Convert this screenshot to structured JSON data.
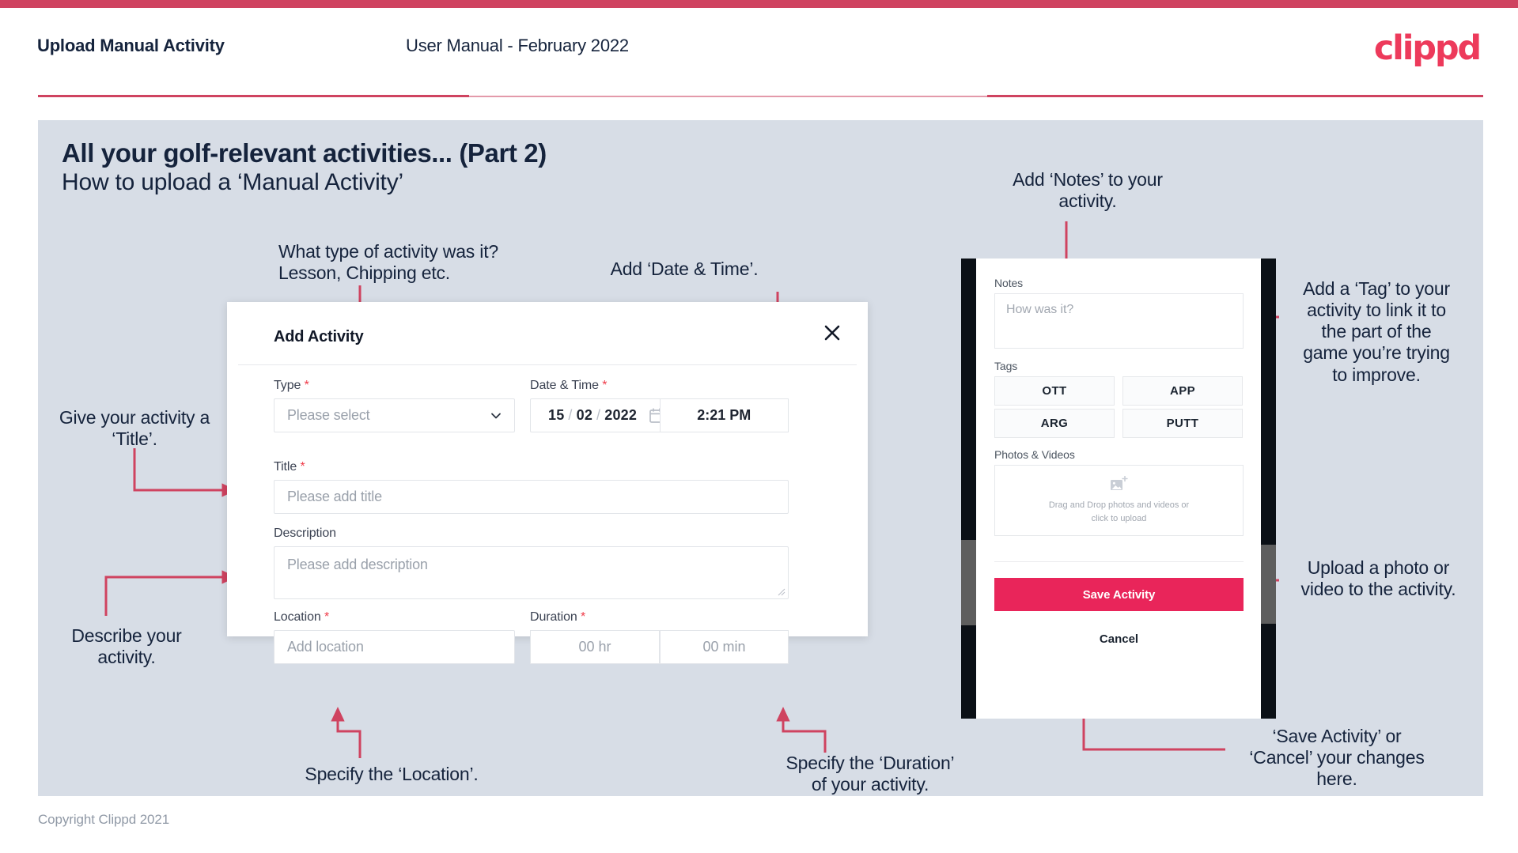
{
  "header": {
    "title": "Upload Manual Activity",
    "subtitle": "User Manual - February 2022",
    "logo": "clippd"
  },
  "slide": {
    "title": "All your golf-relevant activities... (Part 2)",
    "subtitle": "How to upload a ‘Manual Activity’"
  },
  "annotations": {
    "type": "What type of activity was it?\nLesson, Chipping etc.",
    "datetime": "Add ‘Date & Time’.",
    "title": "Give your activity a\n‘Title’.",
    "description": "Describe your\nactivity.",
    "location": "Specify the ‘Location’.",
    "duration": "Specify the ‘Duration’\nof your activity.",
    "notes": "Add ‘Notes’ to your\nactivity.",
    "tags": "Add a ‘Tag’ to your\nactivity to link it to\nthe part of the\ngame you’re trying\nto improve.",
    "upload": "Upload a photo or\nvideo to the activity.",
    "save": "‘Save Activity’ or\n‘Cancel’ your changes\nhere."
  },
  "dialog": {
    "title": "Add Activity",
    "close_label": "✕",
    "fields": {
      "type": {
        "label": "Type",
        "required": true,
        "placeholder": "Please select"
      },
      "datetime": {
        "label": "Date & Time",
        "required": true,
        "day": "15",
        "month": "02",
        "year": "2022",
        "separator": "/",
        "time": "2:21 PM"
      },
      "title": {
        "label": "Title",
        "required": true,
        "placeholder": "Please add title"
      },
      "description": {
        "label": "Description",
        "required": false,
        "placeholder": "Please add description"
      },
      "location": {
        "label": "Location",
        "required": true,
        "placeholder": "Add location"
      },
      "duration": {
        "label": "Duration",
        "required": true,
        "hours": "00 hr",
        "minutes": "00 min"
      }
    }
  },
  "phone": {
    "notes": {
      "label": "Notes",
      "placeholder": "How was it?"
    },
    "tags": {
      "label": "Tags",
      "items": [
        "OTT",
        "APP",
        "ARG",
        "PUTT"
      ]
    },
    "photos": {
      "label": "Photos & Videos",
      "drop_text": "Drag and Drop photos and videos or\nclick to upload"
    },
    "save_label": "Save Activity",
    "cancel_label": "Cancel"
  },
  "footer": {
    "copyright": "Copyright Clippd 2021"
  },
  "colors": {
    "accent": "#cf4360",
    "brand": "#ed3a5b",
    "save_button": "#e9255a",
    "slide_bg": "#d7dde6",
    "text_dark": "#15233c",
    "required": "#ef3a48"
  }
}
